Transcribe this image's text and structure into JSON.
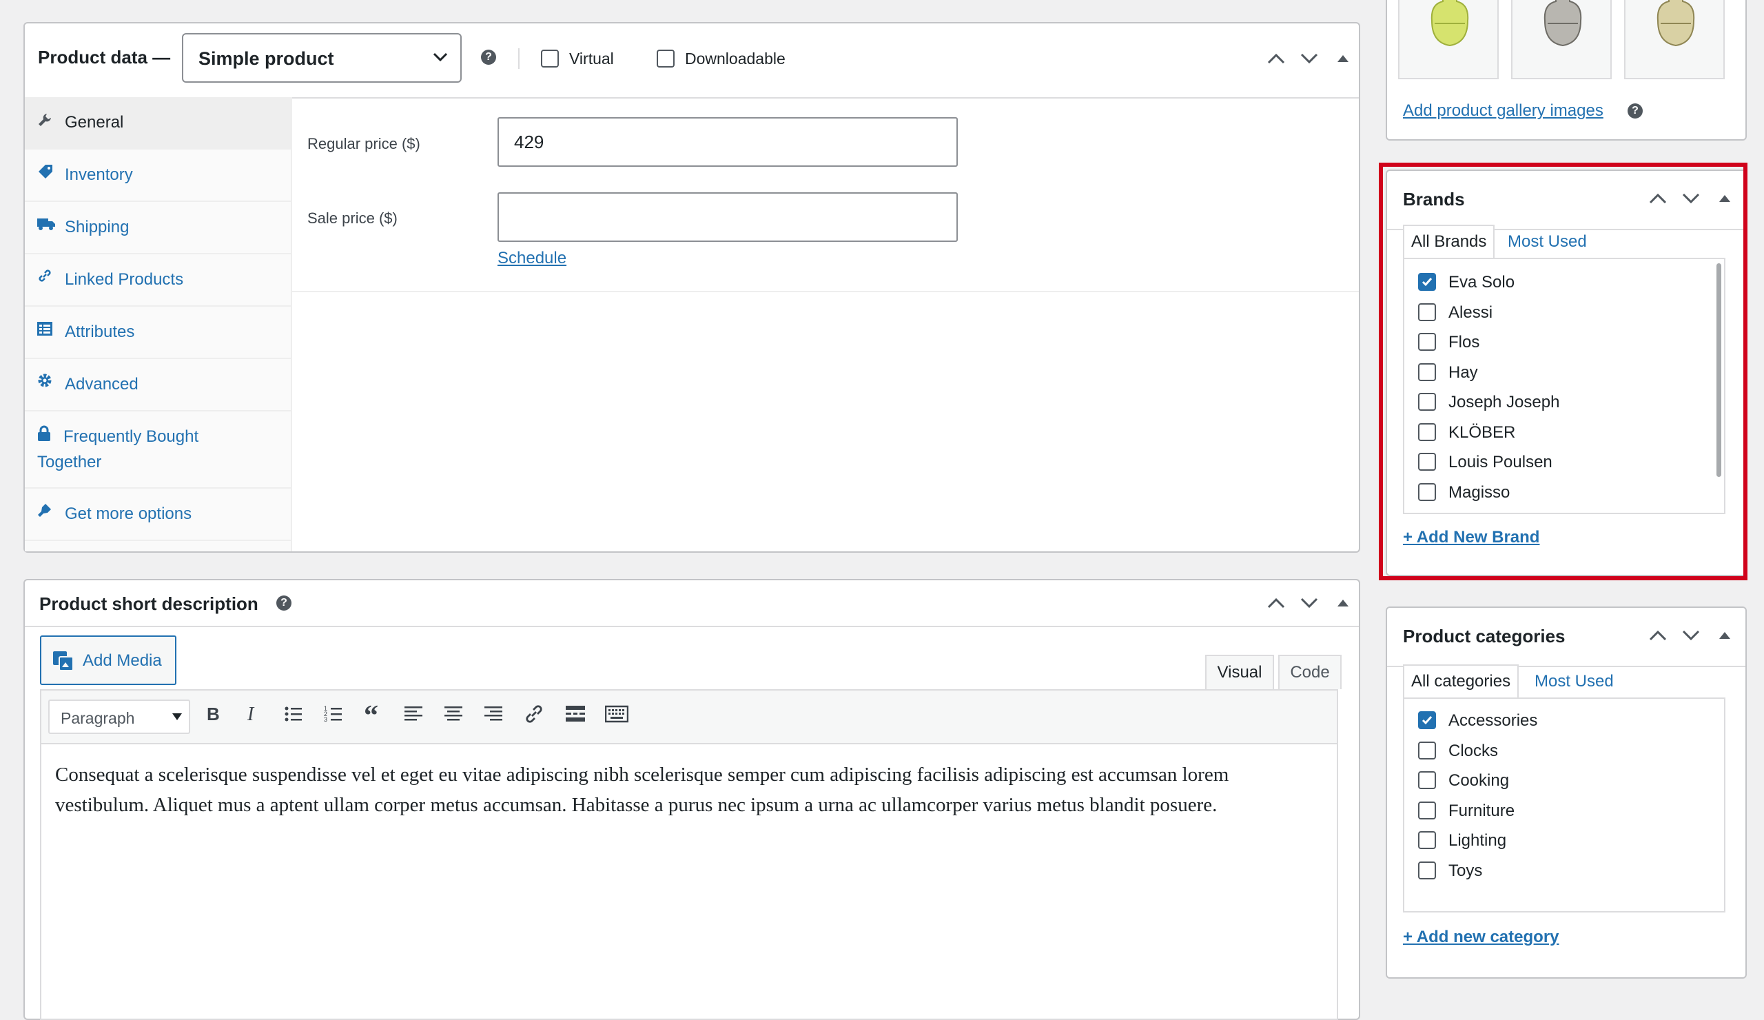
{
  "product_data": {
    "title": "Product data —",
    "type_select": "Simple product",
    "virtual_label": "Virtual",
    "downloadable_label": "Downloadable",
    "tabs": [
      {
        "label": "General",
        "icon": "wrench-icon"
      },
      {
        "label": "Inventory",
        "icon": "tag-icon"
      },
      {
        "label": "Shipping",
        "icon": "truck-icon"
      },
      {
        "label": "Linked Products",
        "icon": "link-icon"
      },
      {
        "label": "Attributes",
        "icon": "list-icon"
      },
      {
        "label": "Advanced",
        "icon": "gear-icon"
      },
      {
        "label_line1": "Frequently Bought",
        "label_line2": "Together",
        "icon": "lock-icon"
      },
      {
        "label": "Get more options",
        "icon": "plug-icon"
      }
    ],
    "regular_price_label": "Regular price ($)",
    "regular_price_value": "429",
    "sale_price_label": "Sale price ($)",
    "sale_price_value": "",
    "schedule_link": "Schedule"
  },
  "short_description": {
    "title": "Product short description",
    "add_media": "Add Media",
    "tab_visual": "Visual",
    "tab_code": "Code",
    "format": "Paragraph",
    "content": "Consequat a scelerisque suspendisse vel et eget eu vitae adipiscing nibh scelerisque semper cum adipiscing facilisis adipiscing est accumsan lorem vestibulum. Aliquet mus a aptent ullam corper metus accumsan. Habitasse a purus nec ipsum a urna ac ullamcorper varius metus blandit posuere."
  },
  "gallery": {
    "add_link": "Add product gallery images"
  },
  "brands": {
    "title": "Brands",
    "tab_all": "All Brands",
    "tab_most_used": "Most Used",
    "items": [
      {
        "label": "Eva Solo",
        "checked": true
      },
      {
        "label": "Alessi",
        "checked": false
      },
      {
        "label": "Flos",
        "checked": false
      },
      {
        "label": "Hay",
        "checked": false
      },
      {
        "label": "Joseph Joseph",
        "checked": false
      },
      {
        "label": "KLÖBER",
        "checked": false
      },
      {
        "label": "Louis Poulsen",
        "checked": false
      },
      {
        "label": "Magisso",
        "checked": false
      }
    ],
    "add_link": "+ Add New Brand"
  },
  "categories": {
    "title": "Product categories",
    "tab_all": "All categories",
    "tab_most_used": "Most Used",
    "items": [
      {
        "label": "Accessories",
        "checked": true
      },
      {
        "label": "Clocks",
        "checked": false
      },
      {
        "label": "Cooking",
        "checked": false
      },
      {
        "label": "Furniture",
        "checked": false
      },
      {
        "label": "Lighting",
        "checked": false
      },
      {
        "label": "Toys",
        "checked": false
      }
    ],
    "add_link": "+ Add new category"
  },
  "colors": {
    "accent": "#2271b1",
    "highlight": "#d0021b"
  }
}
